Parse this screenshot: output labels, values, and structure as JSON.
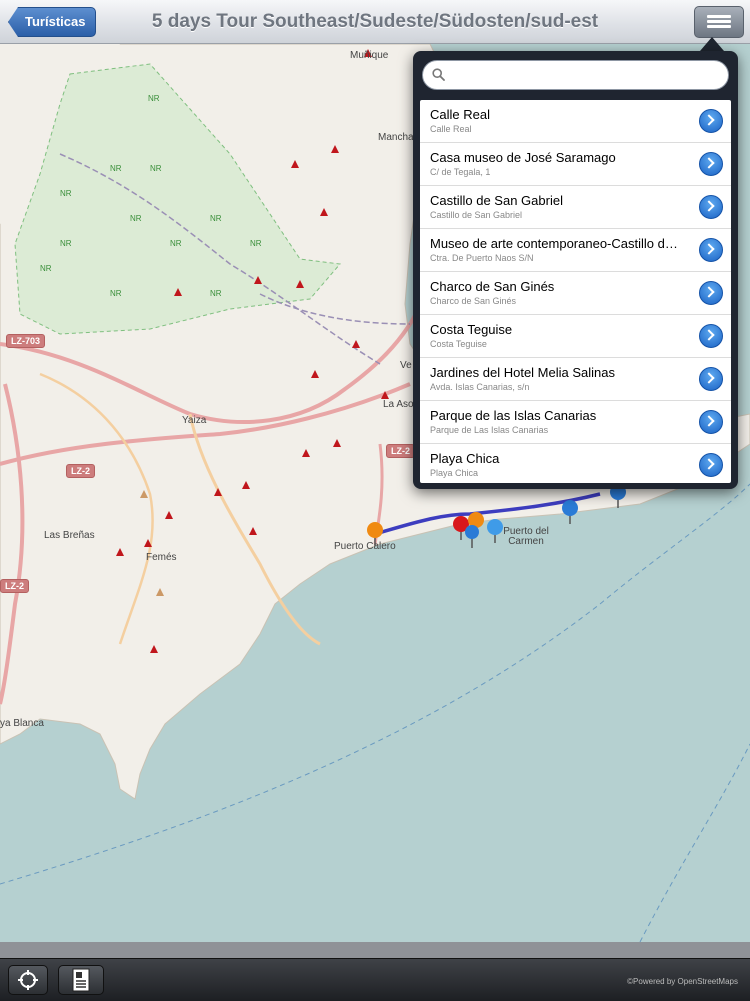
{
  "navbar": {
    "back_label": "Turísticas",
    "title": "5 days Tour Southeast/Sudeste/Südosten/sud-est",
    "menu_icon": "list-icon"
  },
  "search": {
    "placeholder": "",
    "value": ""
  },
  "list": {
    "items": [
      {
        "title": "Calle Real",
        "subtitle": "Calle Real"
      },
      {
        "title": "Casa museo de José Saramago",
        "subtitle": "C/ de Tegala, 1"
      },
      {
        "title": "Castillo de San Gabriel",
        "subtitle": "Castillo de San Gabriel"
      },
      {
        "title": "Museo de arte contemporaneo-Castillo de San José",
        "subtitle": "Ctra. De Puerto Naos S/N"
      },
      {
        "title": "Charco de San Ginés",
        "subtitle": "Charco de San Ginés"
      },
      {
        "title": "Costa Teguise",
        "subtitle": "Costa Teguise"
      },
      {
        "title": "Jardines del Hotel Melia Salinas",
        "subtitle": "Avda. Islas Canarias, s/n"
      },
      {
        "title": "Parque de las Islas Canarias",
        "subtitle": "Parque de Las Islas Canarias"
      },
      {
        "title": "Playa Chica",
        "subtitle": "Playa Chica"
      }
    ]
  },
  "map": {
    "labels": {
      "munique": "Muñique",
      "mancha": "Mancha",
      "yaiza": "Yaiza",
      "las_brenas": "Las Breñas",
      "femes": "Femés",
      "puerto_calero": "Puerto Calero",
      "puerto_carmen": "Puerto del Carmen",
      "playa_blanca": "ya Blanca",
      "vegueta": "Ve",
      "la_asomada": "La Aso"
    },
    "shields": {
      "lz703": "LZ-703",
      "lz2_a": "LZ-2",
      "lz2_b": "LZ-2",
      "lz2_c": "LZ-2"
    },
    "nr_text": "NR"
  },
  "toolbar": {
    "locate_icon": "crosshair-icon",
    "document_icon": "document-icon",
    "attribution": "©Powered by OpenStreetMaps"
  },
  "colors": {
    "land": "#f2efe9",
    "sea": "#b5d0d0",
    "nav_button": "#2b5fa8",
    "route": "#3d3dbf"
  }
}
